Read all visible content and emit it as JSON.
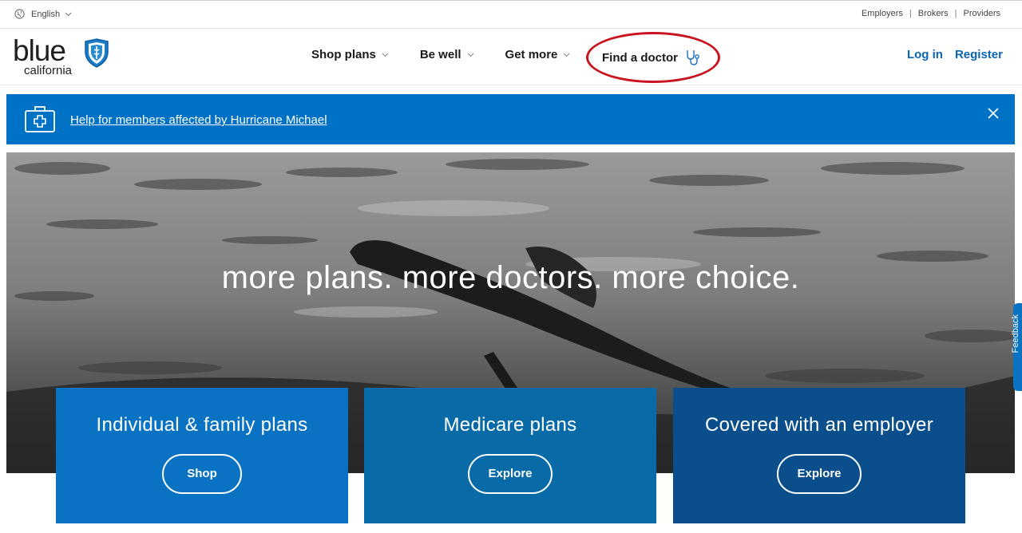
{
  "utility": {
    "language": "English",
    "links": [
      "Employers",
      "Brokers",
      "Providers"
    ]
  },
  "logo": {
    "word": "blue",
    "sub": "california"
  },
  "nav": {
    "items": [
      "Shop plans",
      "Be well",
      "Get more"
    ],
    "find_doctor": "Find a doctor",
    "login": "Log in",
    "register": "Register"
  },
  "alert": {
    "message": "Help for members affected by Hurricane Michael"
  },
  "hero": {
    "tagline": "more plans. more doctors. more choice."
  },
  "cards": [
    {
      "title": "Individual & family plans",
      "button": "Shop"
    },
    {
      "title": "Medicare plans",
      "button": "Explore"
    },
    {
      "title": "Covered with an employer",
      "button": "Explore"
    }
  ],
  "feedback": {
    "label": "Feedback"
  },
  "colors": {
    "brand_blue": "#0072c6",
    "link_blue": "#0a64b4",
    "highlight_red": "#c8141f",
    "card1": "#0a72c2",
    "card2": "#096aa8",
    "card3": "#0a4f8c"
  }
}
